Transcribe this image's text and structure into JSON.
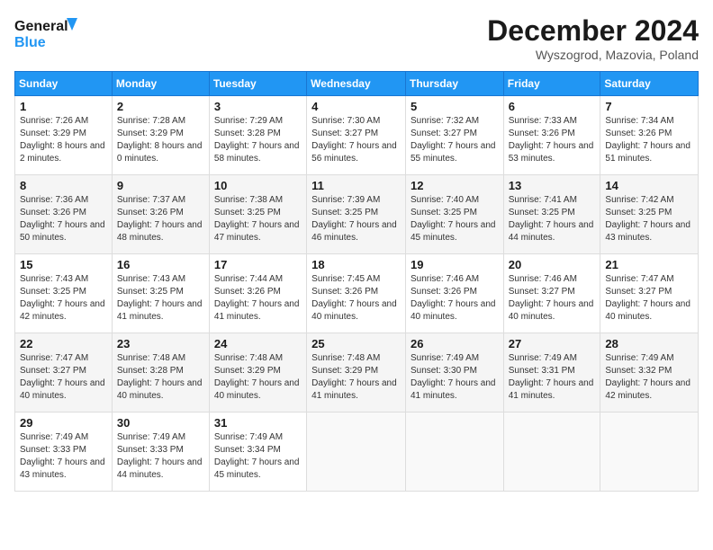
{
  "header": {
    "logo_line1": "General",
    "logo_line2": "Blue",
    "month_title": "December 2024",
    "location": "Wyszogrod, Mazovia, Poland"
  },
  "weekdays": [
    "Sunday",
    "Monday",
    "Tuesday",
    "Wednesday",
    "Thursday",
    "Friday",
    "Saturday"
  ],
  "weeks": [
    [
      {
        "day": "1",
        "sunrise": "Sunrise: 7:26 AM",
        "sunset": "Sunset: 3:29 PM",
        "daylight": "Daylight: 8 hours and 2 minutes."
      },
      {
        "day": "2",
        "sunrise": "Sunrise: 7:28 AM",
        "sunset": "Sunset: 3:29 PM",
        "daylight": "Daylight: 8 hours and 0 minutes."
      },
      {
        "day": "3",
        "sunrise": "Sunrise: 7:29 AM",
        "sunset": "Sunset: 3:28 PM",
        "daylight": "Daylight: 7 hours and 58 minutes."
      },
      {
        "day": "4",
        "sunrise": "Sunrise: 7:30 AM",
        "sunset": "Sunset: 3:27 PM",
        "daylight": "Daylight: 7 hours and 56 minutes."
      },
      {
        "day": "5",
        "sunrise": "Sunrise: 7:32 AM",
        "sunset": "Sunset: 3:27 PM",
        "daylight": "Daylight: 7 hours and 55 minutes."
      },
      {
        "day": "6",
        "sunrise": "Sunrise: 7:33 AM",
        "sunset": "Sunset: 3:26 PM",
        "daylight": "Daylight: 7 hours and 53 minutes."
      },
      {
        "day": "7",
        "sunrise": "Sunrise: 7:34 AM",
        "sunset": "Sunset: 3:26 PM",
        "daylight": "Daylight: 7 hours and 51 minutes."
      }
    ],
    [
      {
        "day": "8",
        "sunrise": "Sunrise: 7:36 AM",
        "sunset": "Sunset: 3:26 PM",
        "daylight": "Daylight: 7 hours and 50 minutes."
      },
      {
        "day": "9",
        "sunrise": "Sunrise: 7:37 AM",
        "sunset": "Sunset: 3:26 PM",
        "daylight": "Daylight: 7 hours and 48 minutes."
      },
      {
        "day": "10",
        "sunrise": "Sunrise: 7:38 AM",
        "sunset": "Sunset: 3:25 PM",
        "daylight": "Daylight: 7 hours and 47 minutes."
      },
      {
        "day": "11",
        "sunrise": "Sunrise: 7:39 AM",
        "sunset": "Sunset: 3:25 PM",
        "daylight": "Daylight: 7 hours and 46 minutes."
      },
      {
        "day": "12",
        "sunrise": "Sunrise: 7:40 AM",
        "sunset": "Sunset: 3:25 PM",
        "daylight": "Daylight: 7 hours and 45 minutes."
      },
      {
        "day": "13",
        "sunrise": "Sunrise: 7:41 AM",
        "sunset": "Sunset: 3:25 PM",
        "daylight": "Daylight: 7 hours and 44 minutes."
      },
      {
        "day": "14",
        "sunrise": "Sunrise: 7:42 AM",
        "sunset": "Sunset: 3:25 PM",
        "daylight": "Daylight: 7 hours and 43 minutes."
      }
    ],
    [
      {
        "day": "15",
        "sunrise": "Sunrise: 7:43 AM",
        "sunset": "Sunset: 3:25 PM",
        "daylight": "Daylight: 7 hours and 42 minutes."
      },
      {
        "day": "16",
        "sunrise": "Sunrise: 7:43 AM",
        "sunset": "Sunset: 3:25 PM",
        "daylight": "Daylight: 7 hours and 41 minutes."
      },
      {
        "day": "17",
        "sunrise": "Sunrise: 7:44 AM",
        "sunset": "Sunset: 3:26 PM",
        "daylight": "Daylight: 7 hours and 41 minutes."
      },
      {
        "day": "18",
        "sunrise": "Sunrise: 7:45 AM",
        "sunset": "Sunset: 3:26 PM",
        "daylight": "Daylight: 7 hours and 40 minutes."
      },
      {
        "day": "19",
        "sunrise": "Sunrise: 7:46 AM",
        "sunset": "Sunset: 3:26 PM",
        "daylight": "Daylight: 7 hours and 40 minutes."
      },
      {
        "day": "20",
        "sunrise": "Sunrise: 7:46 AM",
        "sunset": "Sunset: 3:27 PM",
        "daylight": "Daylight: 7 hours and 40 minutes."
      },
      {
        "day": "21",
        "sunrise": "Sunrise: 7:47 AM",
        "sunset": "Sunset: 3:27 PM",
        "daylight": "Daylight: 7 hours and 40 minutes."
      }
    ],
    [
      {
        "day": "22",
        "sunrise": "Sunrise: 7:47 AM",
        "sunset": "Sunset: 3:27 PM",
        "daylight": "Daylight: 7 hours and 40 minutes."
      },
      {
        "day": "23",
        "sunrise": "Sunrise: 7:48 AM",
        "sunset": "Sunset: 3:28 PM",
        "daylight": "Daylight: 7 hours and 40 minutes."
      },
      {
        "day": "24",
        "sunrise": "Sunrise: 7:48 AM",
        "sunset": "Sunset: 3:29 PM",
        "daylight": "Daylight: 7 hours and 40 minutes."
      },
      {
        "day": "25",
        "sunrise": "Sunrise: 7:48 AM",
        "sunset": "Sunset: 3:29 PM",
        "daylight": "Daylight: 7 hours and 41 minutes."
      },
      {
        "day": "26",
        "sunrise": "Sunrise: 7:49 AM",
        "sunset": "Sunset: 3:30 PM",
        "daylight": "Daylight: 7 hours and 41 minutes."
      },
      {
        "day": "27",
        "sunrise": "Sunrise: 7:49 AM",
        "sunset": "Sunset: 3:31 PM",
        "daylight": "Daylight: 7 hours and 41 minutes."
      },
      {
        "day": "28",
        "sunrise": "Sunrise: 7:49 AM",
        "sunset": "Sunset: 3:32 PM",
        "daylight": "Daylight: 7 hours and 42 minutes."
      }
    ],
    [
      {
        "day": "29",
        "sunrise": "Sunrise: 7:49 AM",
        "sunset": "Sunset: 3:33 PM",
        "daylight": "Daylight: 7 hours and 43 minutes."
      },
      {
        "day": "30",
        "sunrise": "Sunrise: 7:49 AM",
        "sunset": "Sunset: 3:33 PM",
        "daylight": "Daylight: 7 hours and 44 minutes."
      },
      {
        "day": "31",
        "sunrise": "Sunrise: 7:49 AM",
        "sunset": "Sunset: 3:34 PM",
        "daylight": "Daylight: 7 hours and 45 minutes."
      },
      null,
      null,
      null,
      null
    ]
  ]
}
